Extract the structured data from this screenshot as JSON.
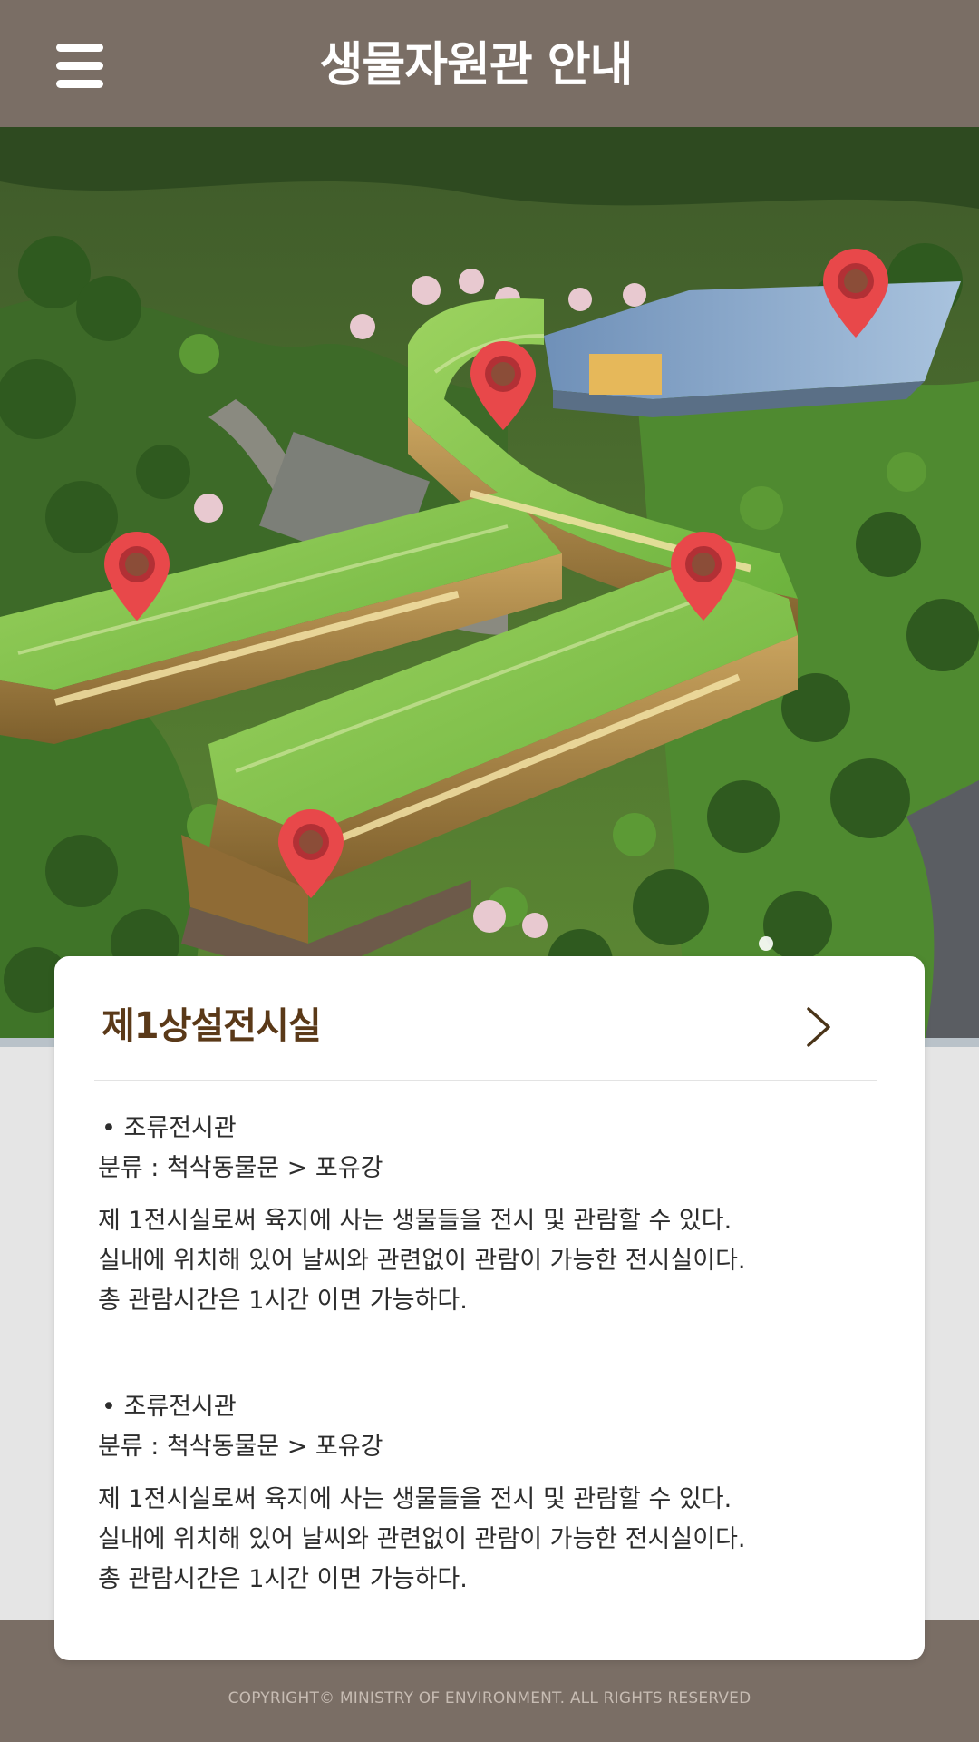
{
  "header": {
    "title": "생물자원관 안내",
    "menu_icon": "hamburger-menu-icon",
    "background": "#7a6e65"
  },
  "map": {
    "pins": [
      {
        "name": "map-pin-1",
        "color": "#e8484a"
      },
      {
        "name": "map-pin-2",
        "color": "#e8484a"
      },
      {
        "name": "map-pin-3",
        "color": "#e8484a"
      },
      {
        "name": "map-pin-4",
        "color": "#e8484a"
      },
      {
        "name": "map-pin-5",
        "color": "#e8484a"
      }
    ]
  },
  "card": {
    "title": "제1상설전시실",
    "arrow_icon": "chevron-right-icon",
    "sections": [
      {
        "name": "• 조류전시관",
        "category": "분류 : 척삭동물문 > 포유강",
        "description": [
          "제 1전시실로써 육지에 사는 생물들을 전시 및  관람할 수 있다.",
          "실내에 위치해 있어 날씨와 관련없이 관람이 가능한 전시실이다.",
          "총 관람시간은 1시간 이면 가능하다."
        ]
      },
      {
        "name": "• 조류전시관",
        "category": "분류 : 척삭동물문 > 포유강",
        "description": [
          "제 1전시실로써 육지에 사는 생물들을 전시 및  관람할 수 있다.",
          "실내에 위치해 있어 날씨와 관련없이 관람이 가능한 전시실이다.",
          "총 관람시간은 1시간 이면 가능하다."
        ]
      }
    ]
  },
  "footer": {
    "copyright": "COPYRIGHT© MINISTRY OF ENVIRONMENT. ALL RIGHTS RESERVED"
  },
  "colors": {
    "brand_brown": "#7a6e65",
    "title_brown": "#5a3918",
    "pin_red": "#e8484a"
  }
}
